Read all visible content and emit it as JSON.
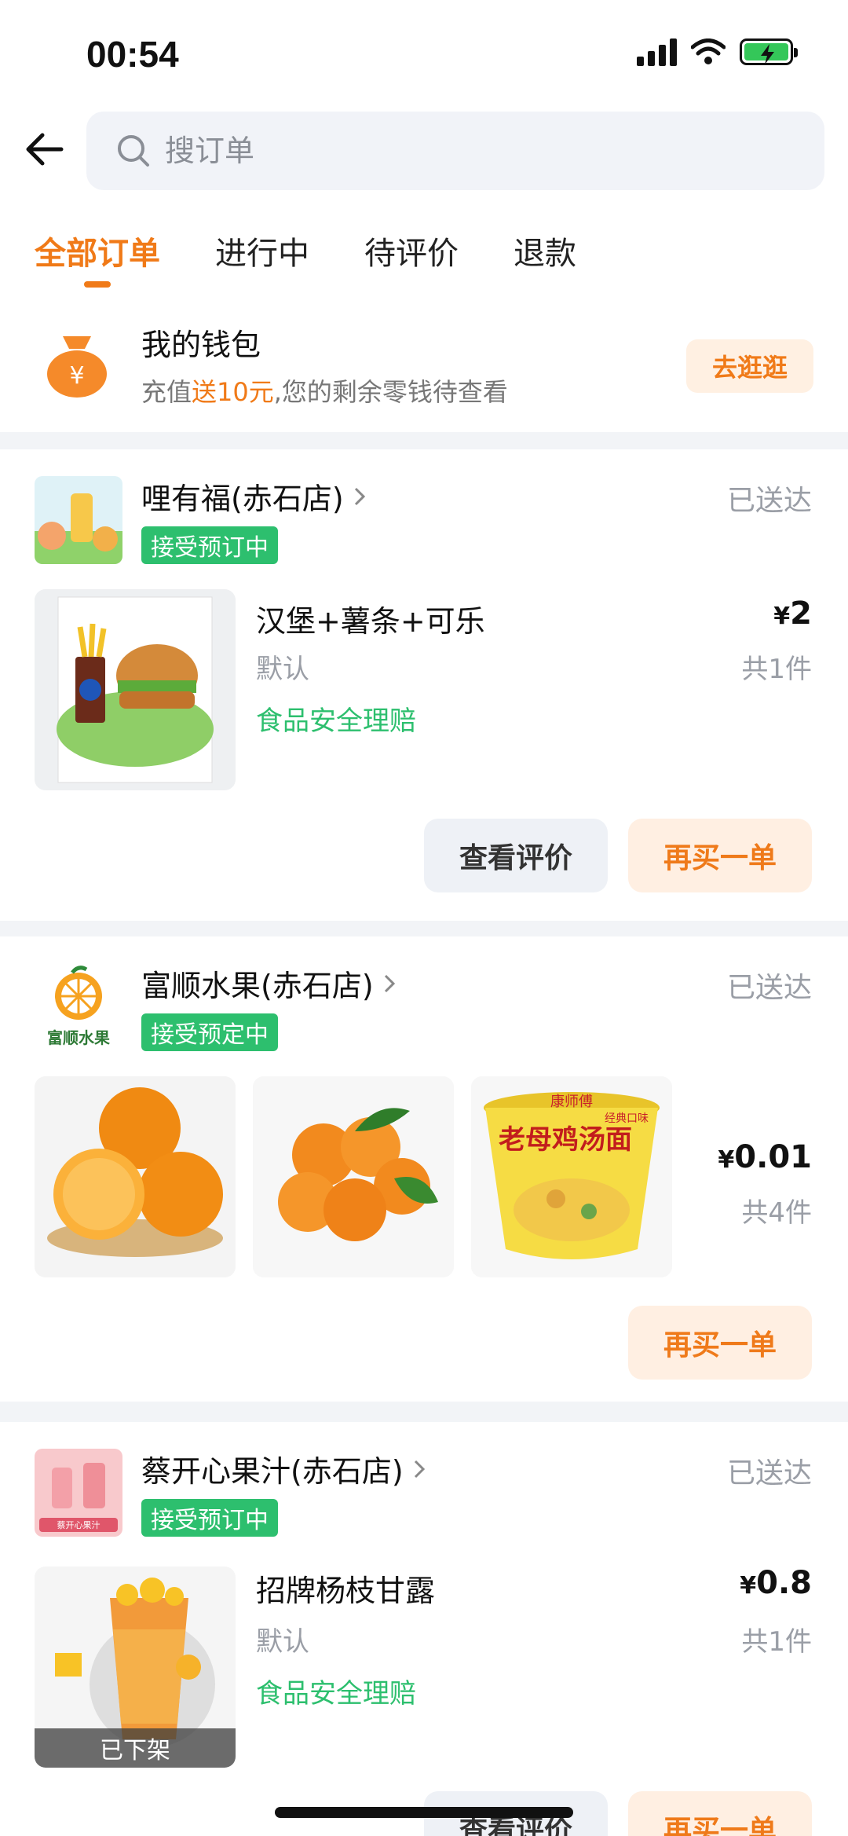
{
  "status_bar": {
    "time": "00:54"
  },
  "header": {
    "search_placeholder": "搜订单"
  },
  "tabs": [
    {
      "label": "全部订单",
      "active": true
    },
    {
      "label": "进行中",
      "active": false
    },
    {
      "label": "待评价",
      "active": false
    },
    {
      "label": "退款",
      "active": false
    }
  ],
  "wallet": {
    "title": "我的钱包",
    "sub_prefix": "充值",
    "sub_highlight": "送10元",
    "sub_suffix": ",您的剩余零钱待查看",
    "button": "去逛逛"
  },
  "orders": [
    {
      "shop": "哩有福(赤石店)",
      "badge": "接受预订中",
      "status": "已送达",
      "item_name": "汉堡+薯条+可乐",
      "spec": "默认",
      "claim": "食品安全理赔",
      "price_symbol": "¥",
      "price": "2",
      "qty": "共1件",
      "btn_review": "查看评价",
      "btn_rebuy": "再买一单"
    },
    {
      "shop": "富顺水果(赤石店)",
      "badge": "接受预定中",
      "status": "已送达",
      "logo_text": "富顺水果",
      "price_symbol": "¥",
      "price": "0.01",
      "qty": "共4件",
      "btn_rebuy": "再买一单",
      "noodle_brand": "康师傅",
      "noodle_name": "老母鸡汤面",
      "noodle_tag": "经典口味"
    },
    {
      "shop": "蔡开心果汁(赤石店)",
      "badge": "接受预订中",
      "status": "已送达",
      "item_name": "招牌杨枝甘露",
      "spec": "默认",
      "claim": "食品安全理赔",
      "price_symbol": "¥",
      "price": "0.8",
      "qty": "共1件",
      "off_shelf": "已下架",
      "logo_text": "蔡开心果汁",
      "btn_review": "查看评价",
      "btn_rebuy": "再买一单"
    }
  ],
  "colors": {
    "accent": "#f07a18",
    "green": "#2dbf6e",
    "background": "#f2f4f7"
  }
}
